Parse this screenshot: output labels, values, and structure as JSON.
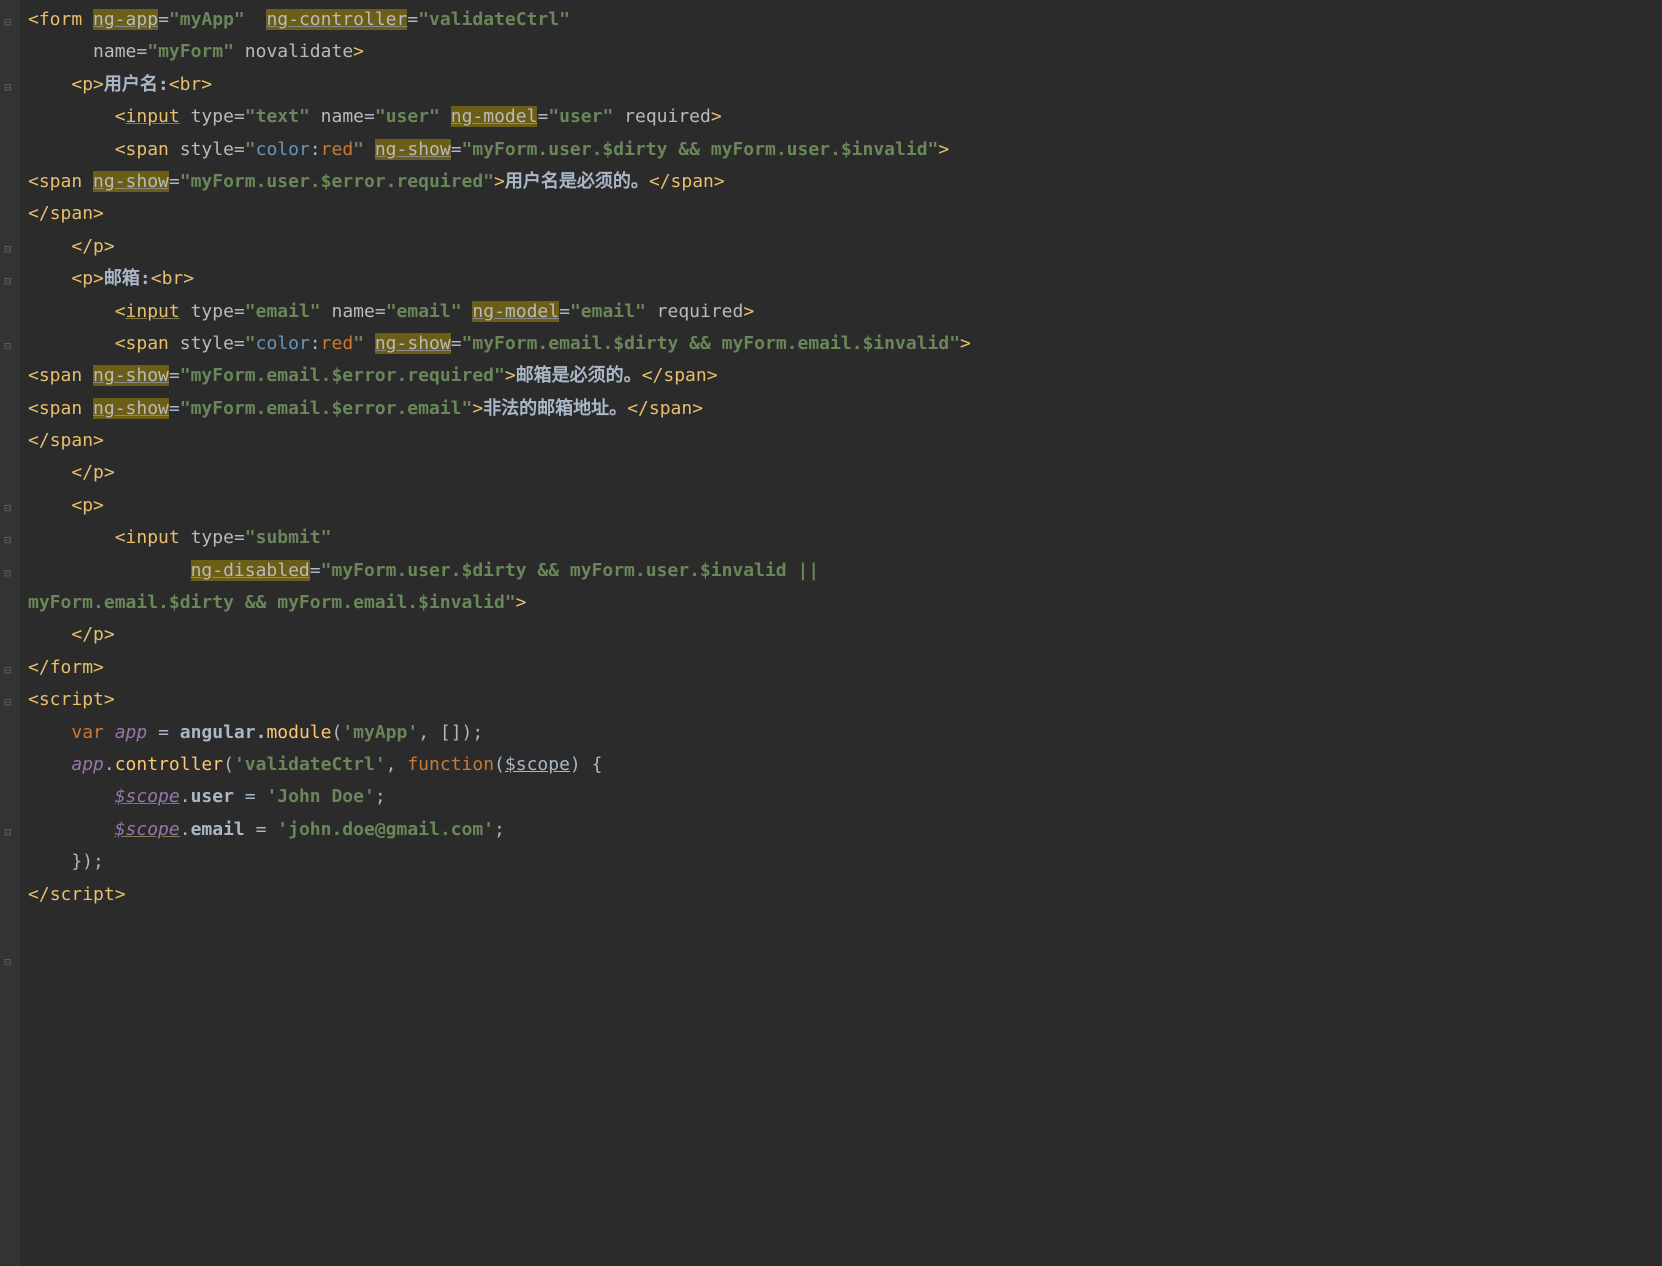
{
  "folds": [
    0,
    2,
    7,
    8,
    10,
    15,
    16,
    17,
    20,
    21,
    25,
    29
  ],
  "tokens": [
    [
      {
        "t": "<",
        "c": "punc"
      },
      {
        "t": "form ",
        "c": "tag"
      },
      {
        "t": "ng-app",
        "c": "attr-hl"
      },
      {
        "t": "=",
        "c": "eq"
      },
      {
        "t": "\"myApp\"",
        "c": "str"
      },
      {
        "t": "  ",
        "c": "txt"
      },
      {
        "t": "ng-controller",
        "c": "attr-hl"
      },
      {
        "t": "=",
        "c": "eq"
      },
      {
        "t": "\"validateCtrl\"",
        "c": "str"
      }
    ],
    [
      {
        "t": "      ",
        "c": "txt"
      },
      {
        "t": "name",
        "c": "attr"
      },
      {
        "t": "=",
        "c": "eq"
      },
      {
        "t": "\"myForm\"",
        "c": "str"
      },
      {
        "t": " ",
        "c": "txt"
      },
      {
        "t": "novalidate",
        "c": "attr"
      },
      {
        "t": ">",
        "c": "punc"
      }
    ],
    [
      {
        "t": "    ",
        "c": "txt"
      },
      {
        "t": "<",
        "c": "punc"
      },
      {
        "t": "p",
        "c": "tag"
      },
      {
        "t": ">",
        "c": "punc"
      },
      {
        "t": "用户名:",
        "c": "txt"
      },
      {
        "t": "<",
        "c": "punc"
      },
      {
        "t": "br",
        "c": "tag"
      },
      {
        "t": ">",
        "c": "punc"
      }
    ],
    [
      {
        "t": "        ",
        "c": "txt"
      },
      {
        "t": "<",
        "c": "punc"
      },
      {
        "t": "input",
        "c": "tag underline"
      },
      {
        "t": " ",
        "c": "txt"
      },
      {
        "t": "type",
        "c": "attr"
      },
      {
        "t": "=",
        "c": "eq"
      },
      {
        "t": "\"text\"",
        "c": "str"
      },
      {
        "t": " ",
        "c": "txt"
      },
      {
        "t": "name",
        "c": "attr"
      },
      {
        "t": "=",
        "c": "eq"
      },
      {
        "t": "\"user\"",
        "c": "str"
      },
      {
        "t": " ",
        "c": "txt"
      },
      {
        "t": "ng-model",
        "c": "attr-hl"
      },
      {
        "t": "=",
        "c": "eq"
      },
      {
        "t": "\"user\"",
        "c": "str"
      },
      {
        "t": " ",
        "c": "txt"
      },
      {
        "t": "required",
        "c": "attr"
      },
      {
        "t": ">",
        "c": "punc"
      }
    ],
    [
      {
        "t": "        ",
        "c": "txt"
      },
      {
        "t": "<",
        "c": "punc"
      },
      {
        "t": "span ",
        "c": "tag"
      },
      {
        "t": "style",
        "c": "attr"
      },
      {
        "t": "=",
        "c": "eq"
      },
      {
        "t": "\"",
        "c": "str"
      },
      {
        "t": "color",
        "c": "css-prop"
      },
      {
        "t": ":",
        "c": "op"
      },
      {
        "t": "red",
        "c": "css-val"
      },
      {
        "t": "\"",
        "c": "str"
      },
      {
        "t": " ",
        "c": "txt"
      },
      {
        "t": "ng-show",
        "c": "attr-hl"
      },
      {
        "t": "=",
        "c": "eq"
      },
      {
        "t": "\"myForm.user.$dirty && myForm.user.$invalid\"",
        "c": "str"
      },
      {
        "t": ">",
        "c": "punc"
      }
    ],
    [
      {
        "t": "<",
        "c": "punc"
      },
      {
        "t": "span ",
        "c": "tag"
      },
      {
        "t": "ng-show",
        "c": "attr-hl"
      },
      {
        "t": "=",
        "c": "eq"
      },
      {
        "t": "\"myForm.user.$error.required\"",
        "c": "str"
      },
      {
        "t": ">",
        "c": "punc"
      },
      {
        "t": "用户名是必须的。",
        "c": "txt"
      },
      {
        "t": "</",
        "c": "punc"
      },
      {
        "t": "span",
        "c": "tag"
      },
      {
        "t": ">",
        "c": "punc"
      }
    ],
    [
      {
        "t": "</",
        "c": "punc"
      },
      {
        "t": "span",
        "c": "tag"
      },
      {
        "t": ">",
        "c": "punc"
      }
    ],
    [
      {
        "t": "    ",
        "c": "txt"
      },
      {
        "t": "</",
        "c": "punc"
      },
      {
        "t": "p",
        "c": "tag"
      },
      {
        "t": ">",
        "c": "punc"
      }
    ],
    [
      {
        "t": "    ",
        "c": "txt"
      },
      {
        "t": "<",
        "c": "punc"
      },
      {
        "t": "p",
        "c": "tag"
      },
      {
        "t": ">",
        "c": "punc"
      },
      {
        "t": "邮箱:",
        "c": "txt"
      },
      {
        "t": "<",
        "c": "punc"
      },
      {
        "t": "br",
        "c": "tag"
      },
      {
        "t": ">",
        "c": "punc"
      }
    ],
    [
      {
        "t": "        ",
        "c": "txt"
      },
      {
        "t": "<",
        "c": "punc"
      },
      {
        "t": "input",
        "c": "tag underline"
      },
      {
        "t": " ",
        "c": "txt"
      },
      {
        "t": "type",
        "c": "attr"
      },
      {
        "t": "=",
        "c": "eq"
      },
      {
        "t": "\"email\"",
        "c": "str"
      },
      {
        "t": " ",
        "c": "txt"
      },
      {
        "t": "name",
        "c": "attr"
      },
      {
        "t": "=",
        "c": "eq"
      },
      {
        "t": "\"email\"",
        "c": "str"
      },
      {
        "t": " ",
        "c": "txt"
      },
      {
        "t": "ng-model",
        "c": "attr-hl"
      },
      {
        "t": "=",
        "c": "eq"
      },
      {
        "t": "\"email\"",
        "c": "str"
      },
      {
        "t": " ",
        "c": "txt"
      },
      {
        "t": "required",
        "c": "attr"
      },
      {
        "t": ">",
        "c": "punc"
      }
    ],
    [
      {
        "t": "        ",
        "c": "txt"
      },
      {
        "t": "<",
        "c": "punc"
      },
      {
        "t": "span ",
        "c": "tag"
      },
      {
        "t": "style",
        "c": "attr"
      },
      {
        "t": "=",
        "c": "eq"
      },
      {
        "t": "\"",
        "c": "str"
      },
      {
        "t": "color",
        "c": "css-prop"
      },
      {
        "t": ":",
        "c": "op"
      },
      {
        "t": "red",
        "c": "css-val"
      },
      {
        "t": "\"",
        "c": "str"
      },
      {
        "t": " ",
        "c": "txt"
      },
      {
        "t": "ng-show",
        "c": "attr-hl"
      },
      {
        "t": "=",
        "c": "eq"
      },
      {
        "t": "\"myForm.email.$dirty && myForm.email.$invalid\"",
        "c": "str"
      },
      {
        "t": ">",
        "c": "punc"
      }
    ],
    [
      {
        "t": "<",
        "c": "punc"
      },
      {
        "t": "span ",
        "c": "tag"
      },
      {
        "t": "ng-show",
        "c": "attr-hl"
      },
      {
        "t": "=",
        "c": "eq"
      },
      {
        "t": "\"myForm.email.$error.required\"",
        "c": "str"
      },
      {
        "t": ">",
        "c": "punc"
      },
      {
        "t": "邮箱是必须的。",
        "c": "txt"
      },
      {
        "t": "</",
        "c": "punc"
      },
      {
        "t": "span",
        "c": "tag"
      },
      {
        "t": ">",
        "c": "punc"
      }
    ],
    [
      {
        "t": "<",
        "c": "punc"
      },
      {
        "t": "span ",
        "c": "tag"
      },
      {
        "t": "ng-show",
        "c": "attr-hl"
      },
      {
        "t": "=",
        "c": "eq"
      },
      {
        "t": "\"myForm.email.$error.email\"",
        "c": "str"
      },
      {
        "t": ">",
        "c": "punc"
      },
      {
        "t": "非法的邮箱地址。",
        "c": "txt"
      },
      {
        "t": "</",
        "c": "punc"
      },
      {
        "t": "span",
        "c": "tag"
      },
      {
        "t": ">",
        "c": "punc"
      }
    ],
    [
      {
        "t": "</",
        "c": "punc"
      },
      {
        "t": "span",
        "c": "tag"
      },
      {
        "t": ">",
        "c": "punc"
      }
    ],
    [
      {
        "t": "    ",
        "c": "txt"
      },
      {
        "t": "</",
        "c": "punc"
      },
      {
        "t": "p",
        "c": "tag"
      },
      {
        "t": ">",
        "c": "punc"
      }
    ],
    [
      {
        "t": "    ",
        "c": "txt"
      },
      {
        "t": "<",
        "c": "punc"
      },
      {
        "t": "p",
        "c": "tag"
      },
      {
        "t": ">",
        "c": "punc"
      }
    ],
    [
      {
        "t": "        ",
        "c": "txt"
      },
      {
        "t": "<",
        "c": "punc"
      },
      {
        "t": "input ",
        "c": "tag"
      },
      {
        "t": "type",
        "c": "attr"
      },
      {
        "t": "=",
        "c": "eq"
      },
      {
        "t": "\"submit\"",
        "c": "str"
      }
    ],
    [
      {
        "t": "               ",
        "c": "txt"
      },
      {
        "t": "ng-disabled",
        "c": "attr-hl"
      },
      {
        "t": "=",
        "c": "eq"
      },
      {
        "t": "\"myForm.user.$dirty && myForm.user.$invalid ||",
        "c": "str"
      }
    ],
    [
      {
        "t": "myForm.email.$dirty && myForm.email.$invalid\"",
        "c": "str"
      },
      {
        "t": ">",
        "c": "punc"
      }
    ],
    [
      {
        "t": "    ",
        "c": "txt"
      },
      {
        "t": "</",
        "c": "punc"
      },
      {
        "t": "p",
        "c": "tag"
      },
      {
        "t": ">",
        "c": "punc"
      }
    ],
    [
      {
        "t": "</",
        "c": "punc"
      },
      {
        "t": "form",
        "c": "tag"
      },
      {
        "t": ">",
        "c": "punc"
      }
    ],
    [
      {
        "t": "<",
        "c": "punc"
      },
      {
        "t": "script",
        "c": "tag"
      },
      {
        "t": ">",
        "c": "punc"
      }
    ],
    [
      {
        "t": "    ",
        "c": "txt"
      },
      {
        "t": "var ",
        "c": "kw"
      },
      {
        "t": "app",
        "c": "ident-it"
      },
      {
        "t": " = ",
        "c": "op"
      },
      {
        "t": "angular.",
        "c": "txt"
      },
      {
        "t": "module",
        "c": "func"
      },
      {
        "t": "(",
        "c": "op"
      },
      {
        "t": "'myApp'",
        "c": "str"
      },
      {
        "t": ", []);",
        "c": "op"
      }
    ],
    [
      {
        "t": "    ",
        "c": "txt"
      },
      {
        "t": "app",
        "c": "ident-it"
      },
      {
        "t": ".",
        "c": "op"
      },
      {
        "t": "controller",
        "c": "func"
      },
      {
        "t": "(",
        "c": "op"
      },
      {
        "t": "'validateCtrl'",
        "c": "str"
      },
      {
        "t": ", ",
        "c": "op"
      },
      {
        "t": "function",
        "c": "jskw"
      },
      {
        "t": "(",
        "c": "op"
      },
      {
        "t": "$scope",
        "c": "param-u"
      },
      {
        "t": ") {",
        "c": "op"
      }
    ],
    [
      {
        "t": "        ",
        "c": "txt"
      },
      {
        "t": "$scope",
        "c": "ident-it underline"
      },
      {
        "t": ".",
        "c": "op"
      },
      {
        "t": "user",
        "c": "txt"
      },
      {
        "t": " = ",
        "c": "op"
      },
      {
        "t": "'John Doe'",
        "c": "str"
      },
      {
        "t": ";",
        "c": "op"
      }
    ],
    [
      {
        "t": "        ",
        "c": "txt"
      },
      {
        "t": "$scope",
        "c": "ident-it underline"
      },
      {
        "t": ".",
        "c": "op"
      },
      {
        "t": "email",
        "c": "txt"
      },
      {
        "t": " = ",
        "c": "op"
      },
      {
        "t": "'john.doe@gmail.com'",
        "c": "str"
      },
      {
        "t": ";",
        "c": "op"
      }
    ],
    [
      {
        "t": "    });",
        "c": "op"
      }
    ],
    [
      {
        "t": "</",
        "c": "punc"
      },
      {
        "t": "script",
        "c": "tag"
      },
      {
        "t": ">",
        "c": "punc"
      }
    ]
  ]
}
